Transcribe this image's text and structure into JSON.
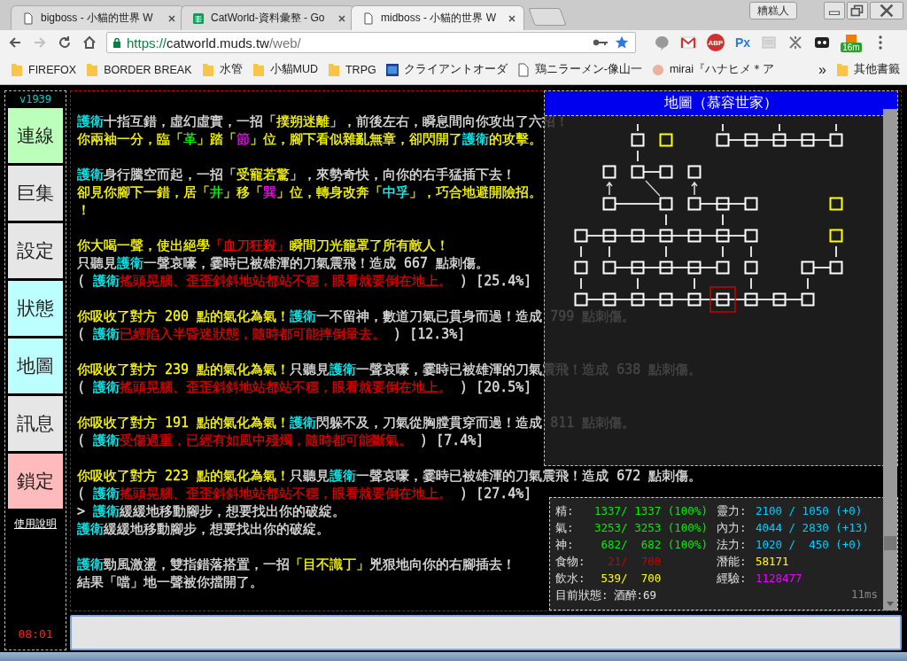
{
  "browser": {
    "tabs": [
      {
        "title": "bigboss - 小貓的世界 W",
        "kind": "page",
        "selected": false
      },
      {
        "title": "CatWorld-資料彙整 - Go",
        "kind": "sheet",
        "selected": false
      },
      {
        "title": "midboss - 小貓的世界 W",
        "kind": "page",
        "selected": true
      }
    ],
    "profile": "糟糕人",
    "nav": [
      {
        "kind": "back",
        "disabled": false
      },
      {
        "kind": "forward",
        "disabled": true
      },
      {
        "kind": "reload",
        "disabled": false
      },
      {
        "kind": "home",
        "disabled": false
      }
    ],
    "url": {
      "scheme": "https://",
      "host": "catworld.muds.tw",
      "path": "/web/"
    },
    "extensions": [
      {
        "kind": "bubble"
      },
      {
        "kind": "mail"
      },
      {
        "kind": "adblock",
        "label": "ABP"
      },
      {
        "kind": "px",
        "label": "Px"
      },
      {
        "kind": "box"
      },
      {
        "kind": "cross"
      },
      {
        "kind": "mask"
      },
      {
        "kind": "timer",
        "badge": "16m"
      }
    ],
    "bookmarks": [
      {
        "label": "FIREFOX",
        "kind": "folder"
      },
      {
        "label": "BORDER BREAK",
        "kind": "folder"
      },
      {
        "label": "水管",
        "kind": "folder"
      },
      {
        "label": "小貓MUD",
        "kind": "folder"
      },
      {
        "label": "TRPG",
        "kind": "folder"
      },
      {
        "label": "クライアントオーダ",
        "kind": "app"
      },
      {
        "label": "鶏ニラーメン-像山一",
        "kind": "page"
      },
      {
        "label": "mirai『ハナヒメ＊ア",
        "kind": "avatar"
      }
    ],
    "more": "»",
    "other": "其他書籤"
  },
  "sidebar": {
    "version": "v1939",
    "buttons": [
      {
        "label": "連線",
        "color": "#bbffbb"
      },
      {
        "label": "巨集",
        "color": "#e6e6e6"
      },
      {
        "label": "設定",
        "color": "#e6e6e6"
      },
      {
        "label": "狀態",
        "color": "#bbffff"
      },
      {
        "label": "地圖",
        "color": "#bbffff"
      },
      {
        "label": "訊息",
        "color": "#e6e6e6"
      },
      {
        "label": "鎖定",
        "color": "#ffbbbb"
      }
    ],
    "help": "使用說明",
    "clock": "08:01"
  },
  "log": [
    [
      [
        {
          "text": "護衛",
          "color": "#00ffff"
        },
        {
          "text": "十指互錯，虛幻虛實，一招「",
          "color": "#e0e0e0"
        },
        {
          "text": "撲朔迷離",
          "color": "#ffff00"
        },
        {
          "text": "」，前後左右，瞬息間向你攻出了六招！",
          "color": "#e0e0e0"
        }
      ],
      [
        {
          "text": "你兩袖一分，臨「",
          "color": "#ffff00"
        },
        {
          "text": "革",
          "color": "#00ff00"
        },
        {
          "text": "」踏「",
          "color": "#ffff00"
        },
        {
          "text": "節",
          "color": "#ff00ff"
        },
        {
          "text": "」位，腳下看似雜亂無章，卻閃開了",
          "color": "#ffff00"
        },
        {
          "text": "護衛",
          "color": "#00ffff"
        },
        {
          "text": "的攻擊。",
          "color": "#ffff00"
        }
      ]
    ],
    [
      [
        {
          "text": "護衛",
          "color": "#00ffff"
        },
        {
          "text": "身行騰空而起，一招「",
          "color": "#e0e0e0"
        },
        {
          "text": "受寵若驚",
          "color": "#ffff00"
        },
        {
          "text": "」，來勢奇快，向你的右手猛插下去！",
          "color": "#e0e0e0"
        }
      ],
      [
        {
          "text": "卻見你腳下一錯，居「",
          "color": "#ffff00"
        },
        {
          "text": "井",
          "color": "#00ff00"
        },
        {
          "text": "」移「",
          "color": "#ffff00"
        },
        {
          "text": "巽",
          "color": "#ff00ff"
        },
        {
          "text": "」位，轉身改奔「",
          "color": "#ffff00"
        },
        {
          "text": "中孚",
          "color": "#00ffff"
        },
        {
          "text": "」，巧合地避開險招。",
          "color": "#ffff00"
        }
      ],
      [
        {
          "text": "！",
          "color": "#ffff00"
        }
      ]
    ],
    [
      [
        {
          "text": "你大喝一聲，使出絕學",
          "color": "#ffff00"
        },
        {
          "text": "「血刀狂殺」",
          "color": "#ff0000"
        },
        {
          "text": "瞬間刀光籠罩了所有敵人！",
          "color": "#ffff00"
        }
      ],
      [
        {
          "text": "只聽見",
          "color": "#e0e0e0"
        },
        {
          "text": "護衛",
          "color": "#00ffff"
        },
        {
          "text": "一聲哀嚎，霎時已被雄渾的刀氣震飛！造成 667 點刺傷。",
          "color": "#e0e0e0"
        }
      ],
      [
        {
          "text": "( ",
          "color": "#e0e0e0"
        },
        {
          "text": "護衛",
          "color": "#00ffff"
        },
        {
          "text": "搖頭晃腦、歪歪斜斜地站都站不穩，眼看就要倒在地上。",
          "color": "#e00000"
        },
        {
          "text": " ) [25.4%]",
          "color": "#e0e0e0"
        }
      ]
    ],
    [
      [
        {
          "text": "你吸收了對方 200 點的氣化為氣！",
          "color": "#ffff00"
        },
        {
          "text": "護衛",
          "color": "#00ffff"
        },
        {
          "text": "一不留神，數道刀氣已貫身而過！造成 799 點刺傷。",
          "color": "#e0e0e0"
        }
      ],
      [
        {
          "text": "( ",
          "color": "#e0e0e0"
        },
        {
          "text": "護衛",
          "color": "#00ffff"
        },
        {
          "text": "已經陷入半昏迷狀態，隨時都可能摔倒暈去。",
          "color": "#e00000"
        },
        {
          "text": " ) [12.3%]",
          "color": "#e0e0e0"
        }
      ]
    ],
    [
      [
        {
          "text": "你吸收了對方 239 點的氣化為氣！",
          "color": "#ffff00"
        },
        {
          "text": "只聽見",
          "color": "#e0e0e0"
        },
        {
          "text": "護衛",
          "color": "#00ffff"
        },
        {
          "text": "一聲哀嚎，霎時已被雄渾的刀氣震飛！造成 638 點刺傷。",
          "color": "#e0e0e0"
        }
      ],
      [
        {
          "text": "( ",
          "color": "#e0e0e0"
        },
        {
          "text": "護衛",
          "color": "#00ffff"
        },
        {
          "text": "搖頭晃腦、歪歪斜斜地站都站不穩，眼看就要倒在地上。",
          "color": "#e00000"
        },
        {
          "text": " ) [20.5%]",
          "color": "#e0e0e0"
        }
      ]
    ],
    [
      [
        {
          "text": "你吸收了對方 191 點的氣化為氣！",
          "color": "#ffff00"
        },
        {
          "text": "護衛",
          "color": "#00ffff"
        },
        {
          "text": "閃躲不及，刀氣從胸膛貫穿而過！造成 811 點刺傷。",
          "color": "#e0e0e0"
        }
      ],
      [
        {
          "text": "( ",
          "color": "#e0e0e0"
        },
        {
          "text": "護衛",
          "color": "#00ffff"
        },
        {
          "text": "受傷過重，已經有如風中殘燭，隨時都可能斷氣。",
          "color": "#e00000"
        },
        {
          "text": " ) [7.4%]",
          "color": "#e0e0e0"
        }
      ]
    ],
    [
      [
        {
          "text": "你吸收了對方 223 點的氣化為氣！",
          "color": "#ffff00"
        },
        {
          "text": "只聽見",
          "color": "#e0e0e0"
        },
        {
          "text": "護衛",
          "color": "#00ffff"
        },
        {
          "text": "一聲哀嚎，霎時已被雄渾的刀氣震飛！造成 672 點刺傷。",
          "color": "#e0e0e0"
        }
      ],
      [
        {
          "text": "( ",
          "color": "#e0e0e0"
        },
        {
          "text": "護衛",
          "color": "#00ffff"
        },
        {
          "text": "搖頭晃腦、歪歪斜斜地站都站不穩，眼看就要倒在地上。",
          "color": "#e00000"
        },
        {
          "text": " ) [27.4%]",
          "color": "#e0e0e0"
        }
      ],
      [
        {
          "text": "> ",
          "color": "#e0e0e0"
        },
        {
          "text": "護衛",
          "color": "#00ffff"
        },
        {
          "text": "緩緩地移動腳步，想要找出你的破綻。",
          "color": "#e0e0e0"
        }
      ],
      [
        {
          "text": "護衛",
          "color": "#00ffff"
        },
        {
          "text": "緩緩地移動腳步，想要找出你的破綻。",
          "color": "#e0e0e0"
        }
      ]
    ],
    [
      [
        {
          "text": "護衛",
          "color": "#00ffff"
        },
        {
          "text": "勁風激盪，雙指錯落搭置，一招",
          "color": "#e0e0e0"
        },
        {
          "text": "「目不識丁」",
          "color": "#ffff00"
        },
        {
          "text": "兇狠地向你的右腳插去！",
          "color": "#e0e0e0"
        }
      ],
      [
        {
          "text": "結果「噹」地一聲被你擋開了。",
          "color": "#e0e0e0"
        }
      ]
    ]
  ],
  "map": {
    "title": "地圖（慕容世家）"
  },
  "status": {
    "left": [
      {
        "label": "精:",
        "value": "1337/ 1337 (100%)",
        "color": "#00ee00"
      },
      {
        "label": "氣:",
        "value": "3253/ 3253 (100%)",
        "color": "#00ee00"
      },
      {
        "label": "神:",
        "value": " 682/  682 (100%)",
        "color": "#00ee00"
      },
      {
        "label": "食物:",
        "value": "  21/  700",
        "color": "#cc0000"
      },
      {
        "label": "飲水:",
        "value": " 539/  700",
        "color": "#ffff00"
      },
      {
        "label": "目前狀態:",
        "value": "酒醉:69",
        "color": "#e0e0e0"
      }
    ],
    "right": [
      {
        "label": "靈力:",
        "value": "2100 / 1050 (+0)",
        "color": "#00ccff"
      },
      {
        "label": "內力:",
        "value": "4044 / 2830 (+13)",
        "color": "#00ccff"
      },
      {
        "label": "法力:",
        "value": "1020 /  450 (+0)",
        "color": "#00ccff"
      },
      {
        "label": "潛能:",
        "value": "58171",
        "color": "#ffff00"
      },
      {
        "label": "經驗:",
        "value": "1128477",
        "color": "#ee00ff"
      }
    ],
    "latency": "11ms"
  }
}
